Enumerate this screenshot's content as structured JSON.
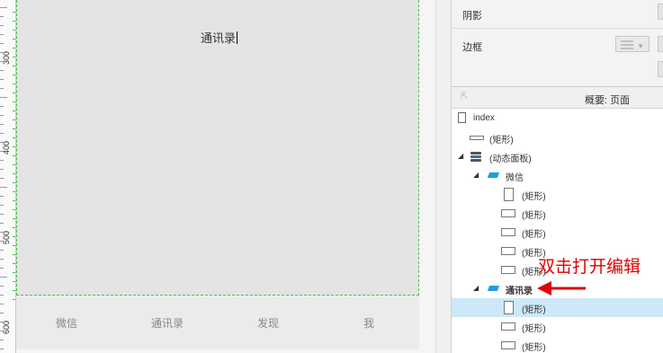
{
  "ruler": {
    "labels": [
      "300",
      "400",
      "500",
      "600"
    ]
  },
  "canvas": {
    "panel_text": "通讯录",
    "tabs": [
      "微信",
      "通讯录",
      "发现",
      "我"
    ]
  },
  "inspector": {
    "shadow_label": "阴影",
    "border_label": "边框"
  },
  "outline": {
    "title": "概要: 页面",
    "nodes": [
      {
        "label": "index"
      },
      {
        "label": "(矩形)"
      },
      {
        "label": "(动态面板)"
      },
      {
        "label": "微信"
      },
      {
        "label": "(矩形)"
      },
      {
        "label": "(矩形)"
      },
      {
        "label": "(矩形)"
      },
      {
        "label": "(矩形)"
      },
      {
        "label": "(矩形)"
      },
      {
        "label": "通讯录"
      },
      {
        "label": "(矩形)"
      },
      {
        "label": "(矩形)"
      },
      {
        "label": "(矩形)"
      }
    ]
  },
  "annotation": {
    "text": "双击打开编辑",
    "color": "#e00000"
  },
  "colors": {
    "selection": "#cde8f6",
    "state_icon": "#1e9ee0",
    "guide": "#4bc24b"
  }
}
